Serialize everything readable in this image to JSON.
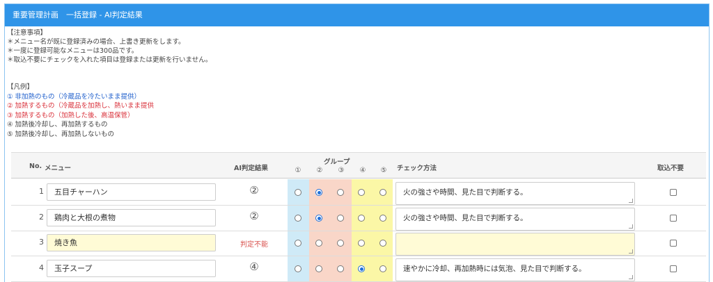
{
  "header": {
    "title": "重要管理計画　一括登録 - AI判定結果"
  },
  "notes": {
    "heading": "【注意事項】",
    "items": [
      "＊メニュー名が既に登録済みの場合、上書き更新をします。",
      "＊一度に登録可能なメニューは300品です。",
      "＊取込不要にチェックを入れた項目は登録または更新を行いません。"
    ]
  },
  "legend": {
    "heading": "【凡例】",
    "items": [
      {
        "text": "① 非加熱のもの（冷蔵品を冷たいまま提供）",
        "color": "#1f5fcc"
      },
      {
        "text": "② 加熱するもの（冷蔵品を加熱し、熱いまま提供",
        "color": "#d9303a"
      },
      {
        "text": "③ 加熱するもの（加熱した後、高温保管）",
        "color": "#d9303a"
      },
      {
        "text": "④ 加熱後冷却し、再加熱するもの",
        "color": "#444444"
      },
      {
        "text": "⑤ 加熱後冷却し、再加熱しないもの",
        "color": "#444444"
      }
    ]
  },
  "table": {
    "headers": {
      "no": "No.",
      "menu": "メニュー",
      "ai": "AI判定結果",
      "group": "グループ",
      "group_numbers": [
        "①",
        "②",
        "③",
        "④",
        "⑤"
      ],
      "check": "チェック方法",
      "exclude": "取込不要"
    },
    "group_colors": [
      "#cfeaf7",
      "#f9d6c8",
      "#f9d6c8",
      "#fbf7a6",
      "#fbf7a6"
    ],
    "rows": [
      {
        "no": "1",
        "menu": "五目チャーハン",
        "ai": "②",
        "ai_fail": false,
        "group": 2,
        "check": "火の強さや時間、見た目で判断する。",
        "highlight": false
      },
      {
        "no": "2",
        "menu": "鶏肉と大根の煮物",
        "ai": "②",
        "ai_fail": false,
        "group": 2,
        "check": "火の強さや時間、見た目で判断する。",
        "highlight": false
      },
      {
        "no": "3",
        "menu": "焼き魚",
        "ai": "判定不能",
        "ai_fail": true,
        "group": 0,
        "check": "",
        "highlight": true
      },
      {
        "no": "4",
        "menu": "玉子スープ",
        "ai": "④",
        "ai_fail": false,
        "group": 4,
        "check": "速やかに冷却、再加熱時には気泡、見た目で判断する。",
        "highlight": false
      }
    ]
  }
}
